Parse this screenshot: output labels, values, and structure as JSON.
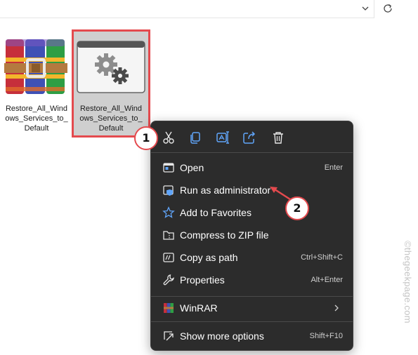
{
  "files": [
    {
      "label": "Restore_All_Windows_Services_to_Default",
      "icon": "winrar-archive-icon",
      "selected": false
    },
    {
      "label": "Restore_All_Windows_Services_to_Default",
      "icon": "batch-file-gear-icon",
      "selected": true
    }
  ],
  "file_label_lines": {
    "rar": [
      "Restore_All_Wind",
      "ows_Services_to_",
      "Default"
    ],
    "bat": [
      "Restore_All_Wind",
      "ows_Services_to_",
      "Default"
    ]
  },
  "menu": {
    "quick_actions": [
      "cut-icon",
      "copy-icon",
      "rename-icon",
      "share-icon",
      "delete-icon"
    ],
    "items": [
      {
        "label": "Open",
        "shortcut": "Enter",
        "icon": "open-icon"
      },
      {
        "label": "Run as administrator",
        "shortcut": "",
        "icon": "shield-icon"
      },
      {
        "label": "Add to Favorites",
        "shortcut": "",
        "icon": "star-icon"
      },
      {
        "label": "Compress to ZIP file",
        "shortcut": "",
        "icon": "zip-folder-icon"
      },
      {
        "label": "Copy as path",
        "shortcut": "Ctrl+Shift+C",
        "icon": "copy-path-icon"
      },
      {
        "label": "Properties",
        "shortcut": "Alt+Enter",
        "icon": "wrench-icon"
      },
      {
        "label": "WinRAR",
        "shortcut": "",
        "icon": "winrar-icon",
        "submenu": true
      },
      {
        "label": "Show more options",
        "shortcut": "Shift+F10",
        "icon": "more-options-icon"
      }
    ]
  },
  "callouts": [
    "1",
    "2"
  ],
  "watermark": "©thegeekpage.com",
  "colors": {
    "highlight": "#e44a4e",
    "menu_bg": "#2c2c2c",
    "accent_blue": "#60a5fa"
  }
}
